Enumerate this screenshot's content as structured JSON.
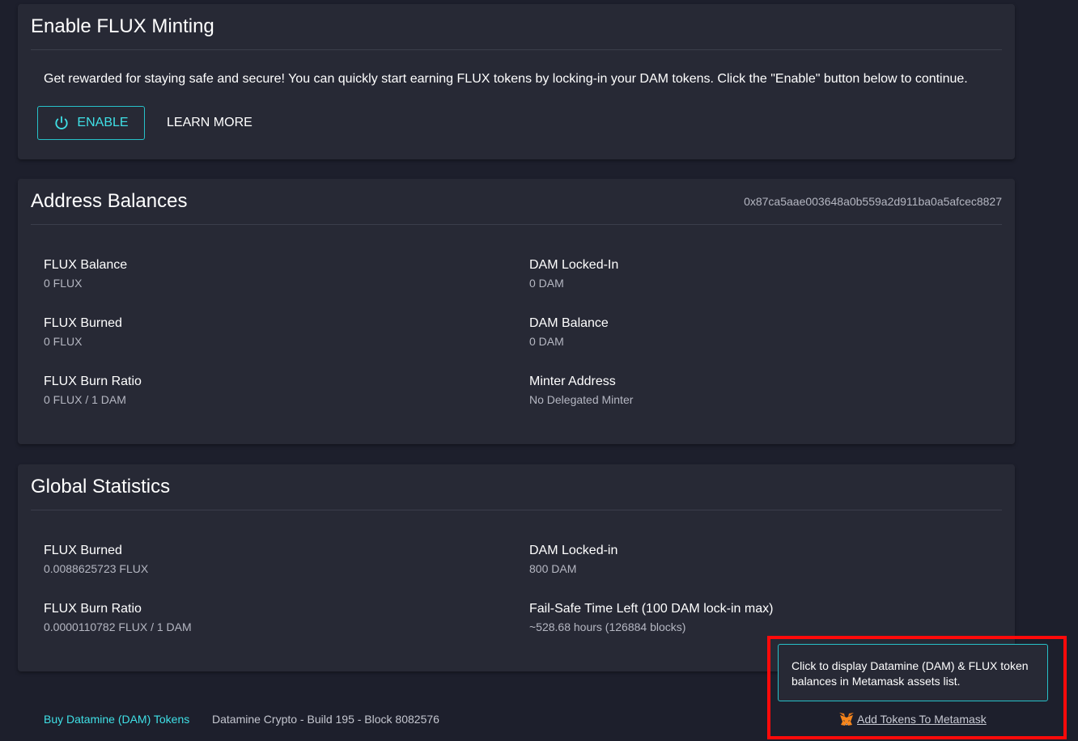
{
  "enable_card": {
    "title": "Enable FLUX Minting",
    "intro": "Get rewarded for staying safe and secure! You can quickly start earning FLUX tokens by locking-in your DAM tokens. Click the \"Enable\" button below to continue.",
    "enable_label": "ENABLE",
    "learn_more_label": "LEARN MORE",
    "enable_icon": "power-icon"
  },
  "balances": {
    "title": "Address Balances",
    "address": "0x87ca5aae003648a0b559a2d911ba0a5afcec8827",
    "left": [
      {
        "label": "FLUX Balance",
        "value": "0 FLUX"
      },
      {
        "label": "FLUX Burned",
        "value": "0 FLUX"
      },
      {
        "label": "FLUX Burn Ratio",
        "value": "0 FLUX / 1 DAM"
      }
    ],
    "right": [
      {
        "label": "DAM Locked-In",
        "value": "0 DAM"
      },
      {
        "label": "DAM Balance",
        "value": "0 DAM"
      },
      {
        "label": "Minter Address",
        "value": "No Delegated Minter"
      }
    ]
  },
  "global": {
    "title": "Global Statistics",
    "left": [
      {
        "label": "FLUX Burned",
        "value": "0.0088625723 FLUX"
      },
      {
        "label": "FLUX Burn Ratio",
        "value": "0.0000110782 FLUX / 1 DAM"
      }
    ],
    "right": [
      {
        "label": "DAM Locked-in",
        "value": "800 DAM"
      },
      {
        "label": "Fail-Safe Time Left (100 DAM lock-in max)",
        "value": "~528.68 hours (126884 blocks)"
      }
    ]
  },
  "footer": {
    "buy_link": "Buy Datamine (DAM) Tokens",
    "build_text": "Datamine Crypto - Build 195 - Block 8082576"
  },
  "metamask": {
    "tooltip": "Click to display Datamine (DAM) & FLUX token balances in Metamask assets list.",
    "link_label": "Add Tokens To Metamask",
    "icon": "metamask-fox-icon"
  },
  "colors": {
    "background": "#1d1f2c",
    "card": "#272935",
    "accent": "#3fe0e6",
    "highlight": "#ff0a0a"
  }
}
